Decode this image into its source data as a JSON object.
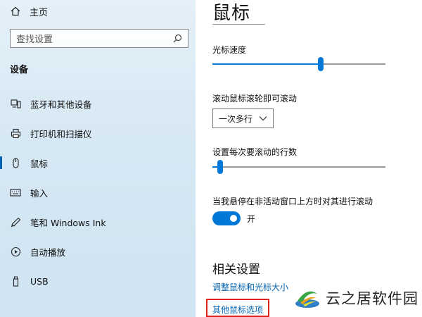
{
  "sidebar": {
    "home": {
      "label": "主页",
      "icon": "home-icon"
    },
    "search": {
      "placeholder": "查找设置",
      "icon": "search-icon"
    },
    "section_title": "设备",
    "items": [
      {
        "label": "蓝牙和其他设备",
        "icon": "bluetooth-devices-icon",
        "selected": false
      },
      {
        "label": "打印机和扫描仪",
        "icon": "printer-icon",
        "selected": false
      },
      {
        "label": "鼠标",
        "icon": "mouse-icon",
        "selected": true
      },
      {
        "label": "输入",
        "icon": "keyboard-icon",
        "selected": false
      },
      {
        "label": "笔和 Windows Ink",
        "icon": "pen-icon",
        "selected": false
      },
      {
        "label": "自动播放",
        "icon": "autoplay-icon",
        "selected": false
      },
      {
        "label": "USB",
        "icon": "usb-icon",
        "selected": false
      }
    ]
  },
  "main": {
    "title": "鼠标",
    "cursor_speed": {
      "label": "光标速度",
      "value_fraction": 0.63
    },
    "scroll_wheel": {
      "label": "滚动鼠标滚轮即可滚动",
      "selected": "一次多行",
      "icon": "chevron-down-icon"
    },
    "lines_per_scroll": {
      "label": "设置每次要滚动的行数",
      "value_fraction": 0.03
    },
    "inactive_scroll": {
      "label": "当我悬停在非活动窗口上方时对其进行滚动",
      "on": true,
      "state_label": "开"
    },
    "related": {
      "title": "相关设置",
      "links": [
        "调整鼠标和光标大小",
        "其他鼠标选项"
      ],
      "highlight_color": "#e0211b"
    }
  },
  "watermark": {
    "text": "云之居软件园"
  },
  "colors": {
    "accent": "#0078d7",
    "link": "#0063b1"
  }
}
